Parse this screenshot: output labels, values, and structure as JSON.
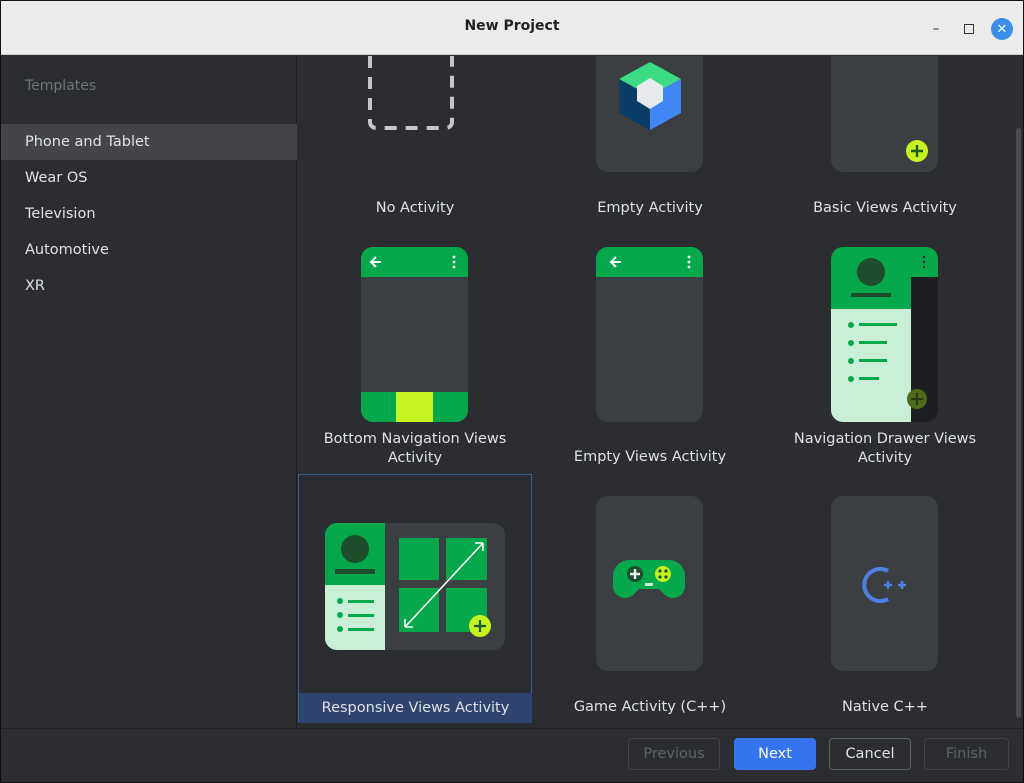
{
  "window": {
    "title": "New Project"
  },
  "sidebar": {
    "section_title": "Templates",
    "items": [
      {
        "label": "Phone and Tablet",
        "selected": true
      },
      {
        "label": "Wear OS",
        "selected": false
      },
      {
        "label": "Television",
        "selected": false
      },
      {
        "label": "Automotive",
        "selected": false
      },
      {
        "label": "XR",
        "selected": false
      }
    ]
  },
  "templates": [
    {
      "label": "No Activity",
      "icon": "dashed-box-icon"
    },
    {
      "label": "Empty Activity",
      "icon": "compose-cube-icon"
    },
    {
      "label": "Basic Views Activity",
      "icon": "fab-plus-icon"
    },
    {
      "label": "Bottom Navigation Views Activity",
      "icon": "bottom-nav-icon"
    },
    {
      "label": "Empty Views Activity",
      "icon": "empty-views-icon"
    },
    {
      "label": "Navigation Drawer Views Activity",
      "icon": "nav-drawer-icon"
    },
    {
      "label": "Responsive Views Activity",
      "icon": "responsive-tablet-icon",
      "selected": true
    },
    {
      "label": "Game Activity (C++)",
      "icon": "gamepad-icon"
    },
    {
      "label": "Native C++",
      "icon": "cpp-icon"
    }
  ],
  "footer": {
    "previous": "Previous",
    "next": "Next",
    "cancel": "Cancel",
    "finish": "Finish"
  },
  "colors": {
    "accent": "#3574f0",
    "android_green": "#05a84a",
    "lime": "#c6f31f",
    "selection": "#2e436e"
  }
}
